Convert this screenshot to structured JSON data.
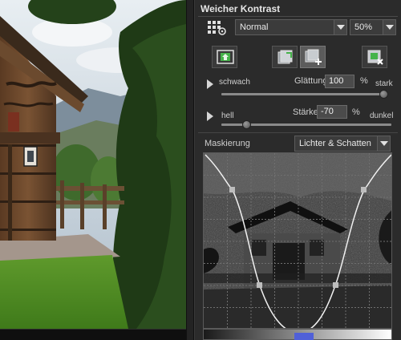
{
  "panel": {
    "title": "Weicher Kontrast",
    "mode": "Normal",
    "opacity": "50%",
    "smoothing": {
      "left_label": "schwach",
      "name": "Glättung",
      "value": "100",
      "unit": "%",
      "right_label": "stark",
      "level": 1.0
    },
    "strength": {
      "left_label": "hell",
      "name": "Stärke",
      "value": "-70",
      "unit": "%",
      "right_label": "dunkel",
      "level": 0.15
    },
    "masking": {
      "label": "Maskierung",
      "mode": "Lichter & Schatten"
    },
    "icons": {
      "presets": "grid-presets-icon",
      "apply": "apply-effect-icon",
      "export": "export-layer-icon",
      "layer": "add-layer-icon",
      "delete": "delete-layer-icon"
    }
  },
  "colors": {
    "panel_bg": "#2b2b2b",
    "field_bg": "#4b4b4b",
    "accent_marker": "#5060d8",
    "apply_icon": "#46b34a"
  }
}
